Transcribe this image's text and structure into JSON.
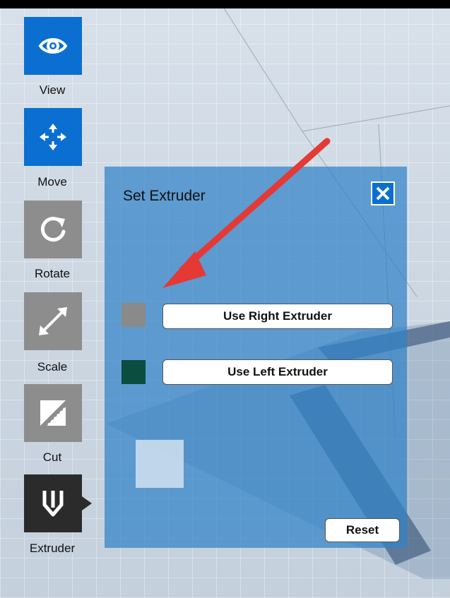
{
  "toolbar": {
    "items": [
      {
        "label": "View",
        "icon": "eye-icon"
      },
      {
        "label": "Move",
        "icon": "move-icon"
      },
      {
        "label": "Rotate",
        "icon": "rotate-icon"
      },
      {
        "label": "Scale",
        "icon": "scale-icon"
      },
      {
        "label": "Cut",
        "icon": "cut-icon"
      },
      {
        "label": "Extruder",
        "icon": "extruder-icon"
      }
    ]
  },
  "dialog": {
    "title": "Set Extruder",
    "right_extruder": {
      "label": "Use Right Extruder",
      "color": "#8a8a8a"
    },
    "left_extruder": {
      "label": "Use Left Extruder",
      "color": "#0b4d3f"
    },
    "reset_label": "Reset"
  },
  "colors": {
    "accent": "#0a6fd0",
    "annotation_arrow": "#e53935"
  }
}
